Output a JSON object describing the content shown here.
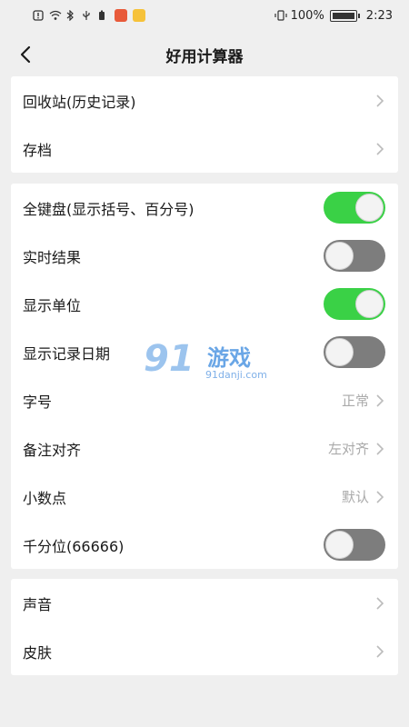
{
  "status_bar": {
    "battery_percent": "100%",
    "time": "2:23"
  },
  "header": {
    "title": "好用计算器"
  },
  "section1": [
    {
      "label": "回收站(历史记录)"
    },
    {
      "label": "存档"
    }
  ],
  "section2": [
    {
      "label": "全键盘(显示括号、百分号)",
      "toggle": true
    },
    {
      "label": "实时结果",
      "toggle": false
    },
    {
      "label": "显示单位",
      "toggle": true
    },
    {
      "label": "显示记录日期",
      "toggle": false
    },
    {
      "label": "字号",
      "value": "正常"
    },
    {
      "label": "备注对齐",
      "value": "左对齐"
    },
    {
      "label": "小数点",
      "value": "默认"
    },
    {
      "label": "千分位(66666)",
      "toggle": false
    }
  ],
  "section3": [
    {
      "label": "声音"
    },
    {
      "label": "皮肤"
    }
  ],
  "watermark": {
    "number": "91",
    "text": "游戏",
    "url": "91danji.com"
  },
  "colors": {
    "toggle_on": "#3ad146",
    "toggle_off": "#7d7d7d",
    "background": "#efefef"
  }
}
